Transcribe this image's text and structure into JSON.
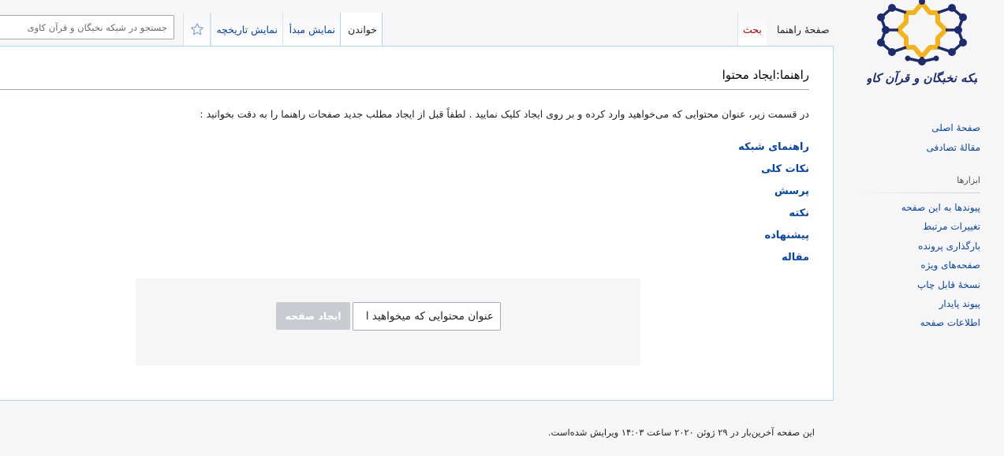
{
  "sidebar": {
    "logo_text": "شبکه نخبگان و قرآن کاوی",
    "nav": [
      {
        "label": "صفحهٔ اصلی"
      },
      {
        "label": "مقالهٔ تصادفی"
      }
    ],
    "tools_heading": "ابزارها",
    "tools": [
      {
        "label": "پیوندها به این صفحه"
      },
      {
        "label": "تغییرات مرتبط"
      },
      {
        "label": "بارگذاری پرونده"
      },
      {
        "label": "صفحه‌های ویژه"
      },
      {
        "label": "نسخهٔ قابل چاپ"
      },
      {
        "label": "پیوند پایدار"
      },
      {
        "label": "اطلاعات صفحه"
      }
    ]
  },
  "tabs": {
    "page": "صفحهٔ راهنما",
    "talk": "بحث",
    "read": "خواندن",
    "view_source": "نمایش مبدأ",
    "history": "نمایش تاریخچه"
  },
  "search": {
    "placeholder": "جستجو در شبکه نخبگان و قرآن کاوی"
  },
  "content": {
    "title": "راهنما:ایجاد محتوا",
    "intro": "در قسمت زیر، عنوان محتوایی که می‌خواهید وارد کرده و بر روی ایجاد کلیک نمایید . لطفاً قبل از ایجاد مطلب جدید صفحات راهنما را به دقت بخوانید :",
    "links": [
      {
        "label": "راهنمای شبکه"
      },
      {
        "label": "نکات کلی"
      },
      {
        "label": "پرسش"
      },
      {
        "label": "نکته"
      },
      {
        "label": "پیشنهاده"
      },
      {
        "label": "مقاله"
      }
    ],
    "create": {
      "placeholder": "عنوان محتوایی که میخواهید ا",
      "button": "ایجاد صفحه"
    }
  },
  "footer": {
    "last_edit": "این صفحه آخرین‌بار در ۲۹ ژوئن ۲۰۲۰ ساعت ۱۴:۰۳ ویرایش شده‌است."
  },
  "colors": {
    "link": "#0645ad",
    "new_link": "#ba0000",
    "logo_navy": "#1c2a6e",
    "logo_gold": "#f4b31a"
  }
}
